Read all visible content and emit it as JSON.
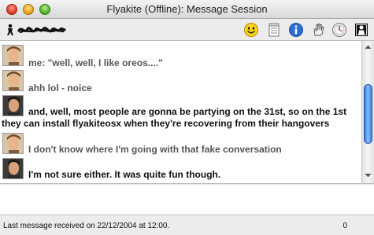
{
  "window": {
    "title": "Flyakite (Offline): Message Session"
  },
  "toolbar": {
    "icons": [
      "smiley-icon",
      "notes-icon",
      "info-icon",
      "hand-icon",
      "clock-icon",
      "block-icon"
    ]
  },
  "messages": [
    {
      "sender": "other",
      "text": "me: \"well, well, I like oreos....\""
    },
    {
      "sender": "other",
      "text": "ahh lol - noice"
    },
    {
      "sender": "me",
      "text": "and, well, most people are gonna be partying on the 31st, so on the 1st",
      "continuation": "they can install flyakiteosx when they're recovering from their hangovers"
    },
    {
      "sender": "other",
      "text": "I don't know where I'm going with that fake conversation"
    },
    {
      "sender": "me",
      "text": "I'm not sure either.  It was quite fun though."
    }
  ],
  "input": {
    "value": ""
  },
  "statusbar": {
    "text": "Last message received on 22/12/2004 at 12:00.",
    "char_count": "0"
  },
  "colors": {
    "other_text": "#555555",
    "me_text": "#111111",
    "scroll_thumb": "#3d7fdc"
  }
}
